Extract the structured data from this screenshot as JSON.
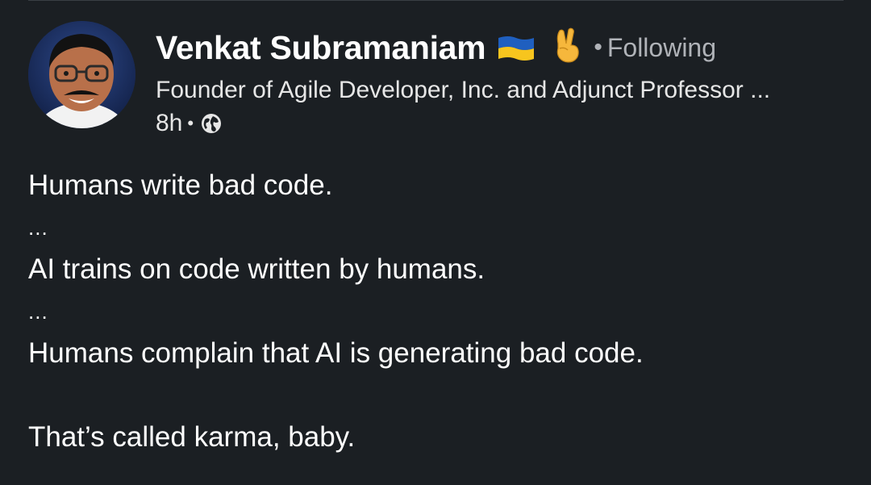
{
  "post": {
    "author_name": "Venkat Subramaniam",
    "follow_status": "Following",
    "dot": "•",
    "headline": "Founder of Agile Developer, Inc. and Adjunct Professor ...",
    "time_ago": "8h",
    "visibility_icon": "globe-icon",
    "author_icons": [
      "ukraine-flag-icon",
      "victory-hand-icon"
    ],
    "body_lines": [
      "Humans write bad code.",
      "...",
      "AI trains on code written by humans.",
      "...",
      "Humans complain that AI is generating bad code.",
      "",
      "That’s called karma, baby."
    ]
  },
  "colors": {
    "background": "#1b1f23",
    "text": "#ffffff",
    "muted": "#b0b3b8",
    "flag_blue": "#1f5fbf",
    "flag_yellow": "#f7c51e"
  }
}
